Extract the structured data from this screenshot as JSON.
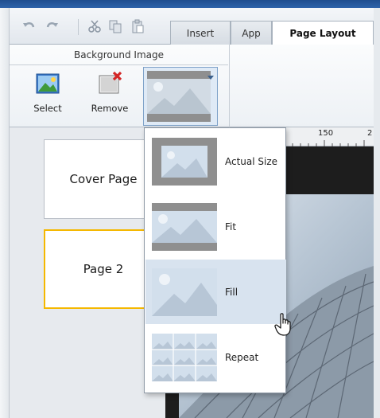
{
  "tabs": [
    {
      "label": "Insert",
      "active": false
    },
    {
      "label": "App",
      "active": false
    },
    {
      "label": "Page Layout",
      "active": true
    }
  ],
  "ribbon": {
    "group_title": "Background Image",
    "select_label": "Select",
    "remove_label": "Remove"
  },
  "pages": [
    {
      "label": "Cover Page",
      "selected": false
    },
    {
      "label": "Page 2",
      "selected": true
    }
  ],
  "ruler": {
    "labels": [
      "150",
      "2"
    ]
  },
  "dropdown": {
    "items": [
      {
        "label": "Actual Size",
        "icon": "actual-size-icon"
      },
      {
        "label": "Fit",
        "icon": "fit-icon"
      },
      {
        "label": "Fill",
        "icon": "fill-icon",
        "hover": true
      },
      {
        "label": "Repeat",
        "icon": "repeat-icon"
      }
    ]
  },
  "colors": {
    "accent": "#2e63aa",
    "selected_page_border": "#f5b800",
    "hover_bg": "#d8e3ef"
  }
}
